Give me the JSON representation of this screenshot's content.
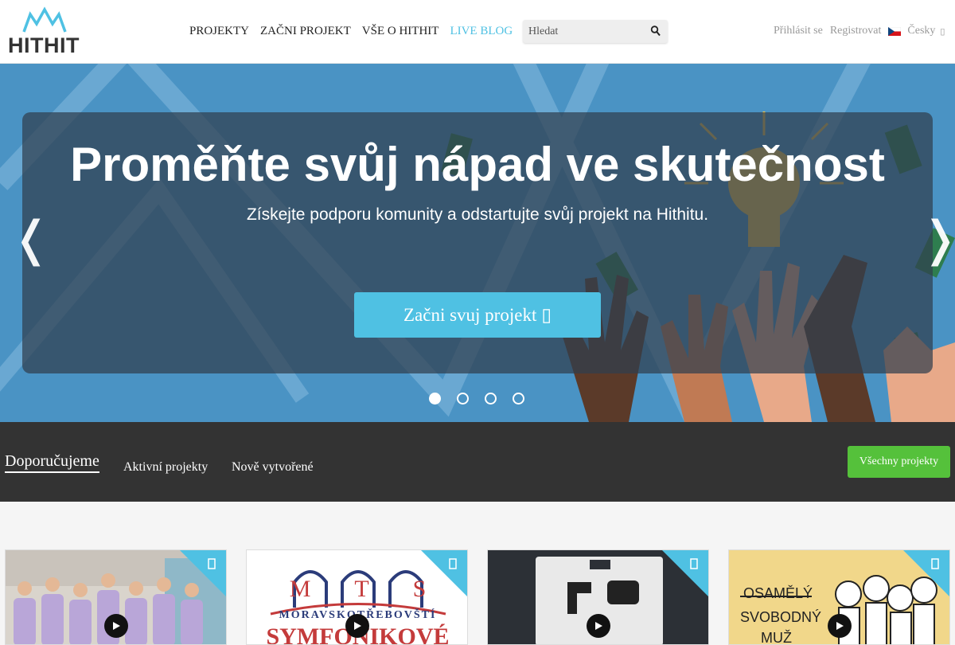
{
  "brand": {
    "name": "HITHIT"
  },
  "nav": {
    "items": [
      {
        "label": "PROJEKTY"
      },
      {
        "label": "ZAČNI PROJEKT"
      },
      {
        "label": "VŠE O HITHIT"
      },
      {
        "label": "LIVE BLOG"
      }
    ]
  },
  "search": {
    "placeholder": "Hledat",
    "icon": "search-icon"
  },
  "user": {
    "login": "Přihlásit se",
    "register": "Registrovat",
    "language": "Česky"
  },
  "hero": {
    "title": "Proměňte svůj nápad ve skutečnost",
    "subtitle": "Získejte podporu komunity a odstartujte svůj projekt na Hithitu.",
    "cta": "Začni svuj projekt",
    "prev": "❬",
    "next": "❭",
    "slides": 4,
    "active_slide": 1
  },
  "tabs": {
    "items": [
      {
        "label": "Doporučujeme"
      },
      {
        "label": "Aktivní projekty"
      },
      {
        "label": "Nově vytvořené"
      }
    ],
    "all_button": "Všechny projekty"
  },
  "cards": {
    "texts": {
      "mts_letters": "M T S",
      "mts_line": "MORAVSKOTŘEBOVŠTÍ",
      "mts_big": "SYMFONIKOVÉ",
      "comic_1": "OSAMĚLÝ",
      "comic_2": "SVOBODNÝ",
      "comic_3": "MUŽ"
    }
  },
  "colors": {
    "accent": "#4fc1e3",
    "green": "#55c13b",
    "dark": "#333333",
    "hero_panel": "#303e4e"
  }
}
